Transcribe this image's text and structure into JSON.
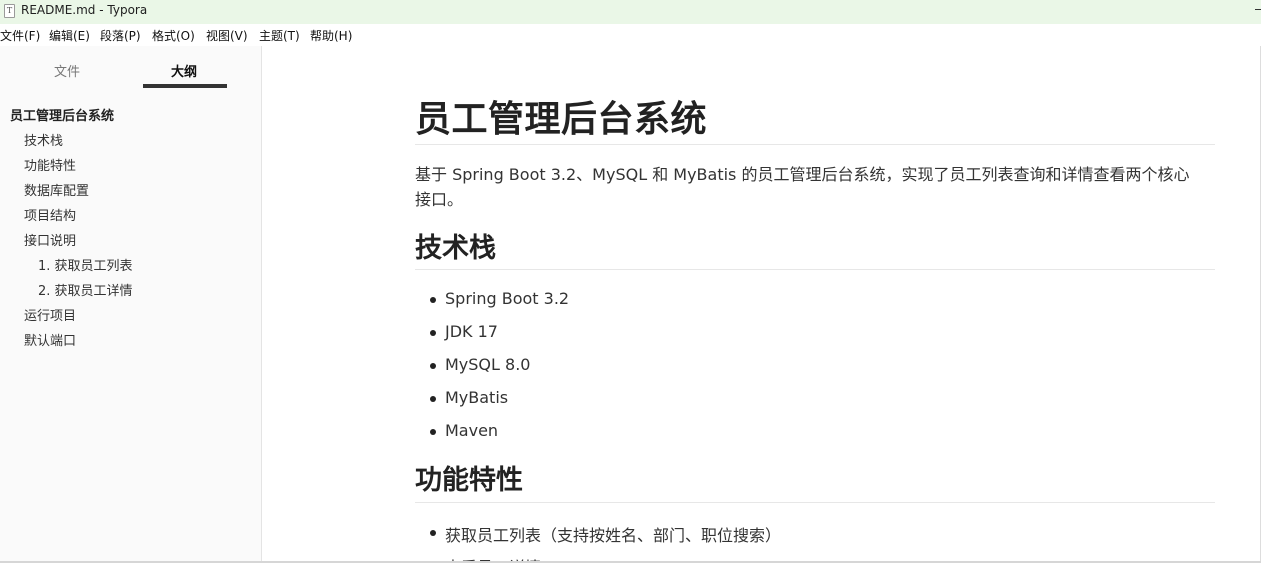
{
  "window": {
    "title": "README.md - Typora",
    "icon_letter": "T"
  },
  "menu": [
    "文件(F)",
    "编辑(E)",
    "段落(P)",
    "格式(O)",
    "视图(V)",
    "主题(T)",
    "帮助(H)"
  ],
  "sidebar": {
    "tabs": [
      "文件",
      "大纲"
    ],
    "active_tab": "大纲",
    "outline": [
      "员工管理后台系统",
      "技术栈",
      "功能特性",
      "数据库配置",
      "项目结构",
      "接口说明",
      "1. 获取员工列表",
      "2. 获取员工详情",
      "运行项目",
      "默认端口"
    ],
    "footer": {
      "prev_icon": "chevron-left-icon",
      "source_icon": "source-code-icon"
    }
  },
  "document": {
    "title": "员工管理后台系统",
    "intro": "基于 Spring Boot 3.2、MySQL 和 MyBatis 的员工管理后台系统，实现了员工列表查询和详情查看两个核心接口。",
    "sections": [
      {
        "heading": "技术栈",
        "items": [
          "Spring Boot 3.2",
          "JDK 17",
          "MySQL 8.0",
          "MyBatis",
          "Maven"
        ]
      },
      {
        "heading": "功能特性",
        "items": [
          "获取员工列表（支持按姓名、部门、职位搜索）",
          "查看员工详情"
        ]
      }
    ]
  },
  "colors": {
    "titlebar_bg": "#eaf7e7",
    "sidebar_bg": "#fafafa",
    "text": "#333333"
  }
}
